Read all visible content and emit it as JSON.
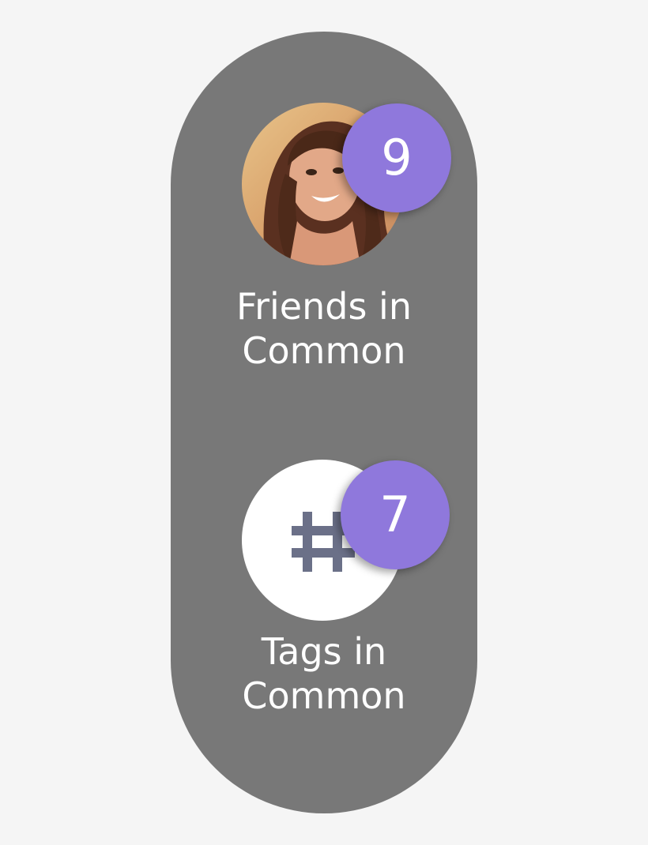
{
  "friends_in_common": {
    "count": "9",
    "label_line1": "Friends in",
    "label_line2": "Common"
  },
  "tags_in_common": {
    "count": "7",
    "label_line1": "Tags in",
    "label_line2": "Common",
    "icon": "hash-icon"
  },
  "colors": {
    "panel": "#787878",
    "badge": "#8f78dc",
    "text": "#ffffff",
    "icon": "#6b7088",
    "page_background": "#f5f5f5"
  }
}
